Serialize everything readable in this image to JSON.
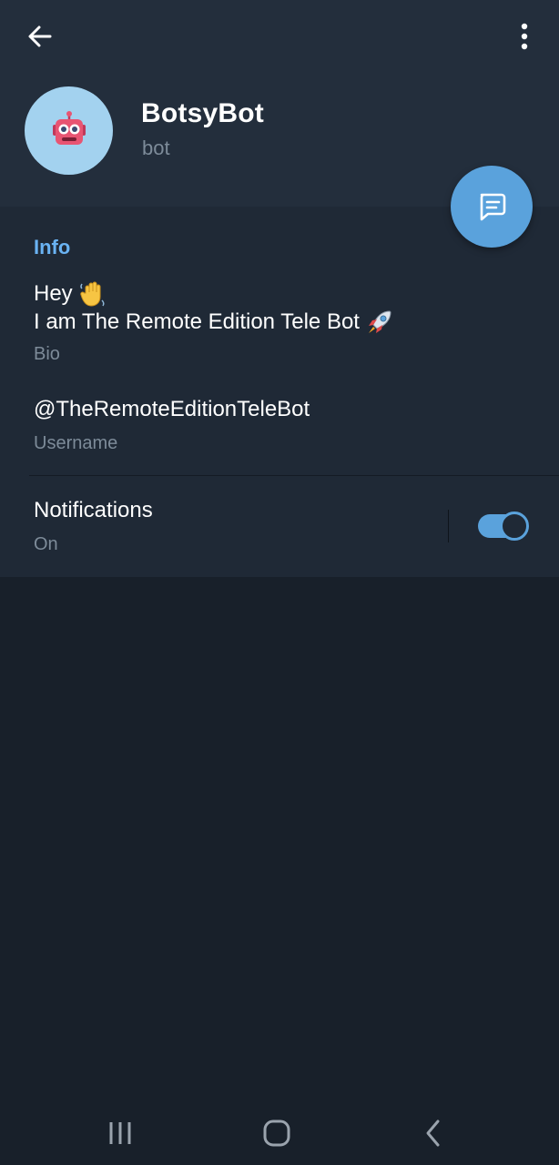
{
  "header": {
    "title": "BotsyBot",
    "subtitle": "bot",
    "icons": {
      "back": "arrow-left-icon",
      "menu": "more-vertical-icon",
      "avatar": "robot-face-icon",
      "fab": "message-icon"
    }
  },
  "info": {
    "section_title": "Info",
    "bio_line1": "Hey",
    "bio_line2": "I am The Remote Edition Tele Bot",
    "bio_emojis": [
      "waving-hand-icon",
      "rocket-icon"
    ],
    "bio_caption": "Bio",
    "username": "@TheRemoteEditionTeleBot",
    "username_caption": "Username"
  },
  "notifications": {
    "label": "Notifications",
    "status": "On",
    "enabled": true
  },
  "navbar": {
    "icons": [
      "recent-apps-icon",
      "home-icon",
      "back-icon"
    ]
  },
  "colors": {
    "header_bg": "#232e3c",
    "card_bg": "#1f2936",
    "page_bg": "#18202a",
    "accent": "#5aa2dc",
    "section_title": "#6ab3f3",
    "secondary_text": "#7d8b99"
  }
}
